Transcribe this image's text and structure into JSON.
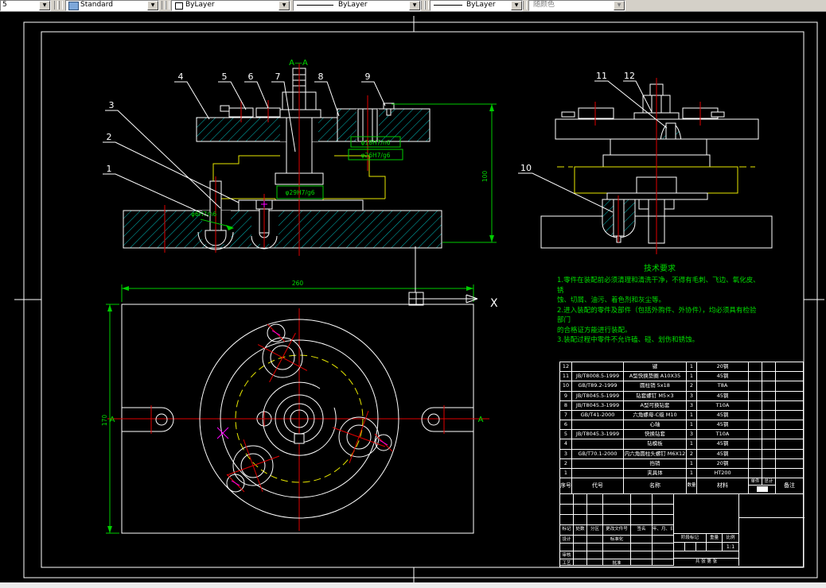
{
  "toolbar": {
    "layer_value": "5",
    "style_label": "Standard",
    "color_label": "ByLayer",
    "linetype_label": "ByLayer",
    "lineweight_label": "ByLayer",
    "plotstyle_label": "随颜色"
  },
  "drawing": {
    "section_label": "A—A",
    "balloons": [
      "1",
      "2",
      "3",
      "4",
      "5",
      "6",
      "7",
      "8",
      "9",
      "10",
      "11",
      "12"
    ],
    "dims": {
      "d18": "φ18H7/n6",
      "d26": "φ26H7/g6",
      "d29": "φ29H7/g6",
      "d6": "φ6H7/n6",
      "height": "100",
      "width": "260",
      "depth": "170"
    },
    "axis_label": "X",
    "section_mark_left": "A",
    "section_mark_right": "A"
  },
  "tech_notes": {
    "title": "技术要求",
    "lines": [
      "1.零件在装配前必须清理和清洗干净，不得有毛刺、飞边、氧化皮、锈",
      "蚀、切屑、油污、着色剂和灰尘等。",
      "2.进入装配的零件及部件（包括外购件、外协件），均必须具有检验部门",
      "的合格证方能进行装配。",
      "3.装配过程中零件不允许磕、碰、划伤和锈蚀。"
    ]
  },
  "bom": {
    "headers": {
      "no": "序号",
      "code": "代号",
      "name": "名称",
      "qty": "数量",
      "material": "材料",
      "unit": "单件",
      "total": "总计",
      "weight": "重量",
      "remark": "备注"
    },
    "rows": [
      {
        "no": "12",
        "code": "",
        "name": "键",
        "qty": "1",
        "material": "20钢"
      },
      {
        "no": "11",
        "code": "JB/T8008.5-1999",
        "name": "A型快换垫圈 A10X35",
        "qty": "1",
        "material": "45钢"
      },
      {
        "no": "10",
        "code": "GB/T89.2-1999",
        "name": "圆柱销 5x18",
        "qty": "2",
        "material": "T8A"
      },
      {
        "no": "9",
        "code": "JB/T8045.5-1999",
        "name": "钻套螺钉 M5×3",
        "qty": "3",
        "material": "45钢"
      },
      {
        "no": "8",
        "code": "JB/T8045.3-1999",
        "name": "A型可换钻套",
        "qty": "3",
        "material": "T10A"
      },
      {
        "no": "7",
        "code": "GB/T41-2000",
        "name": "六角螺母-C级 M10",
        "qty": "1",
        "material": "45钢"
      },
      {
        "no": "6",
        "code": "",
        "name": "心轴",
        "qty": "1",
        "material": "45钢"
      },
      {
        "no": "5",
        "code": "JB/T8045.3-1999",
        "name": "快换钻套",
        "qty": "3",
        "material": "T10A"
      },
      {
        "no": "4",
        "code": "",
        "name": "钻模板",
        "qty": "1",
        "material": "45钢"
      },
      {
        "no": "3",
        "code": "GB/T70.1-2000",
        "name": "内六角圆柱头螺钉 M6X12",
        "qty": "2",
        "material": "45钢"
      },
      {
        "no": "2",
        "code": "",
        "name": "挡销",
        "qty": "1",
        "material": "20钢"
      },
      {
        "no": "1",
        "code": "",
        "name": "夹具体",
        "qty": "1",
        "material": "HT200"
      }
    ]
  },
  "title_block": {
    "mark": "标记",
    "count": "处数",
    "zone": "分区",
    "change_file": "更改文件号",
    "sign": "签名",
    "date": "年、月、日",
    "design": "设计",
    "standardize": "标准化",
    "stage": "阶段标记",
    "weight": "重量",
    "scale": "比例",
    "scale_value": "1:1",
    "audit": "审核",
    "process": "工艺",
    "approve": "批准",
    "sheets": "共 张 第 张"
  },
  "colors": {
    "line_white": "#ffffff",
    "hatch_cyan": "#00b8b8",
    "centerline_red": "#e00000",
    "dimension_green": "#00dd00",
    "part_yellow": "#e8e800",
    "mark_magenta": "#ff00ff"
  }
}
